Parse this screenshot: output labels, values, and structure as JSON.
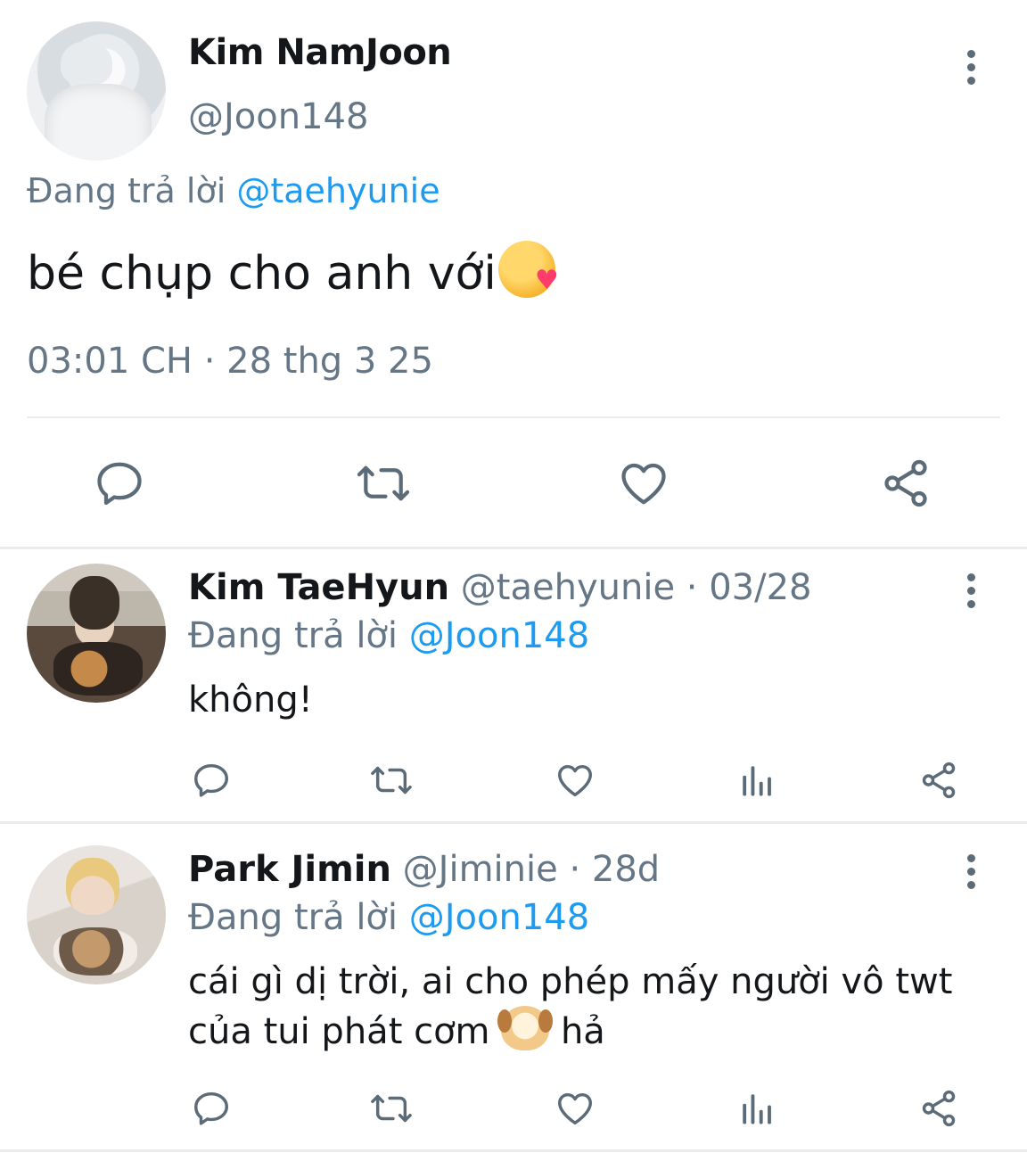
{
  "main_tweet": {
    "author_name": "Kim NamJoon",
    "author_handle": "@Joon148",
    "replying_prefix": "Đang trả lời ",
    "replying_to": "@taehyunie",
    "text": "bé chụp cho anh với",
    "emoji": "face-blowing-a-kiss",
    "timestamp": "03:01 CH · 28 thg 3 25"
  },
  "replies": [
    {
      "author_name": "Kim TaeHyun",
      "meta": " @taehyunie · 03/28",
      "replying_prefix": "Đang trả lời ",
      "replying_to": "@Joon148",
      "text": "không!"
    },
    {
      "author_name": "Park Jimin",
      "meta": " @Jiminie · 28d",
      "replying_prefix": "Đang trả lời ",
      "replying_to": "@Joon148",
      "text_before_emoji": "cái gì dị trời, ai cho phép mấy người vô twt của tui phát cơm ",
      "emoji": "dog-face",
      "text_after_emoji": " hả"
    }
  ],
  "icons": {
    "reply": "speech-bubble-icon",
    "retweet": "retweet-arrows-icon",
    "like": "heart-icon",
    "stats": "bar-chart-icon",
    "share": "share-nodes-icon",
    "more": "vertical-dots-icon"
  },
  "colors": {
    "link": "#1d9bf0",
    "secondary_text": "#657786",
    "icon": "#5b6b78",
    "divider": "#e6ecf0"
  }
}
